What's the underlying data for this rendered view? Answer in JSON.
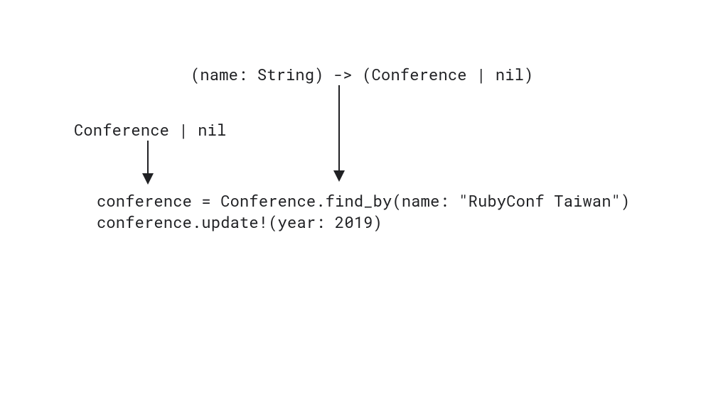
{
  "signature": "(name: String) -> (Conference | nil)",
  "inferred_type": "Conference | nil",
  "code_line1": "conference = Conference.find_by(name: \"RubyConf Taiwan\")",
  "code_line2": "conference.update!(year: 2019)"
}
